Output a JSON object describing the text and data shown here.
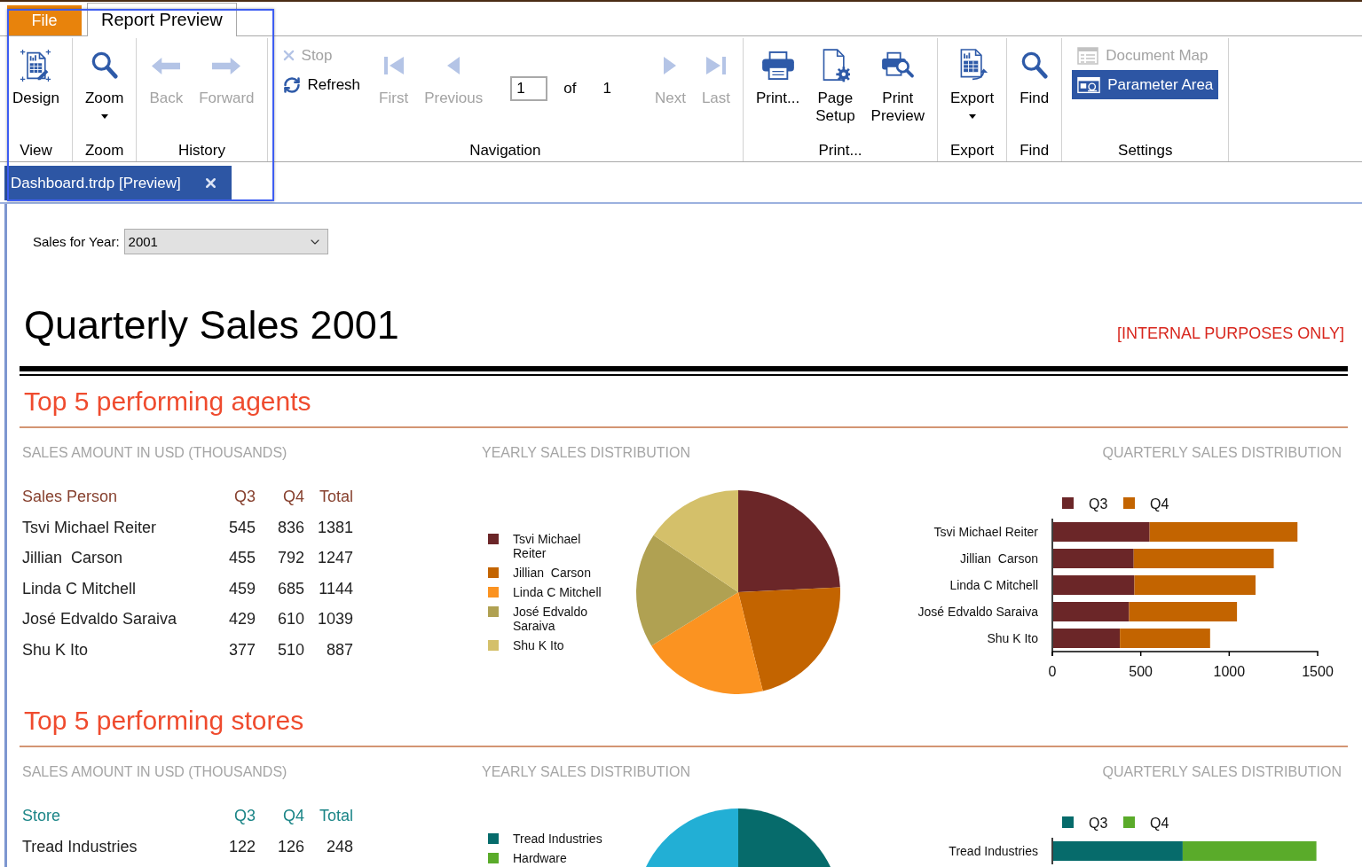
{
  "tabs": [
    {
      "label": "File",
      "kind": "menu",
      "selected": false
    },
    {
      "label": "Report Preview",
      "kind": "tab",
      "selected": true
    }
  ],
  "ribbon": {
    "groups": [
      {
        "label": "View",
        "items": [
          {
            "kind": "large",
            "label": "Design",
            "disabled": false
          }
        ]
      },
      {
        "label": "Zoom",
        "items": [
          {
            "kind": "large",
            "label": "Zoom",
            "disabled": false,
            "dropdown": true
          }
        ]
      },
      {
        "label": "History",
        "items": [
          {
            "kind": "large",
            "label": "Back",
            "disabled": true
          },
          {
            "kind": "large",
            "label": "Forward",
            "disabled": true
          }
        ]
      },
      {
        "label": "Navigation",
        "items": [
          {
            "kind": "stack",
            "buttons": [
              {
                "label": "Stop",
                "disabled": true
              },
              {
                "label": "Refresh",
                "disabled": false
              }
            ]
          },
          {
            "kind": "large",
            "label": "First",
            "disabled": true
          },
          {
            "kind": "large",
            "label": "Previous",
            "disabled": true
          },
          {
            "kind": "pager",
            "value": "1",
            "of_label": "of",
            "total": "1"
          },
          {
            "kind": "large",
            "label": "Next",
            "disabled": true
          },
          {
            "kind": "large",
            "label": "Last",
            "disabled": true
          }
        ]
      },
      {
        "label": "Print...",
        "items": [
          {
            "kind": "large",
            "label": "Print...",
            "disabled": false
          },
          {
            "kind": "large",
            "label": "Page Setup",
            "disabled": false
          },
          {
            "kind": "large",
            "label": "Print Preview",
            "disabled": false
          }
        ]
      },
      {
        "label": "Export",
        "items": [
          {
            "kind": "large",
            "label": "Export",
            "disabled": false,
            "dropdown": true
          }
        ]
      },
      {
        "label": "Find",
        "items": [
          {
            "kind": "large",
            "label": "Find",
            "disabled": false
          }
        ]
      },
      {
        "label": "Settings",
        "items": [
          {
            "kind": "stack",
            "buttons": [
              {
                "label": "Document Map",
                "disabled": true,
                "selected": false
              },
              {
                "label": "Parameter Area",
                "disabled": false,
                "selected": true
              }
            ]
          }
        ]
      }
    ]
  },
  "document_tabs": [
    {
      "label": "Dashboard.trdp [Preview]",
      "selected": true
    }
  ],
  "parameters": [
    {
      "label": "Sales for Year:",
      "value": "2001"
    }
  ],
  "report": {
    "title": "Quarterly Sales 2001",
    "notice": "[INTERNAL PURPOSES ONLY]",
    "sections": [
      {
        "title": "Top 5 performing agents",
        "color": "#87412f",
        "table": {
          "title": "SALES AMOUNT IN USD (THOUSANDS)",
          "columns": [
            "Sales Person",
            "Q3",
            "Q4",
            "Total"
          ],
          "rows": [
            [
              "Tsvi Michael Reiter",
              "545",
              "836",
              "1381"
            ],
            [
              "Jillian  Carson",
              "455",
              "792",
              "1247"
            ],
            [
              "Linda C Mitchell",
              "459",
              "685",
              "1144"
            ],
            [
              "José Edvaldo Saraiva",
              "429",
              "610",
              "1039"
            ],
            [
              "Shu K Ito",
              "377",
              "510",
              "887"
            ]
          ]
        },
        "yearly": {
          "title": "YEARLY SALES DISTRIBUTION",
          "legend": [
            {
              "label": "Tsvi Michael Reiter",
              "color": "#6b2628"
            },
            {
              "label": "Jillian  Carson",
              "color": "#c36400"
            },
            {
              "label": "Linda C Mitchell",
              "color": "#fb9321"
            },
            {
              "label": "José Edvaldo Saraiva",
              "color": "#b0a152"
            },
            {
              "label": "Shu K Ito",
              "color": "#d4c06a"
            }
          ]
        },
        "quarterly": {
          "title": "QUARTERLY SALES DISTRIBUTION",
          "chart_data": {
            "type": "bar",
            "orientation": "horizontal",
            "stacked": true,
            "legend": "top",
            "categories": [
              "Tsvi Michael Reiter",
              "Jillian  Carson",
              "Linda C Mitchell",
              "José Edvaldo Saraiva",
              "Shu K Ito"
            ],
            "series": [
              {
                "name": "Q3",
                "color": "#6b2628",
                "values": [
                  545,
                  455,
                  459,
                  429,
                  377
                ]
              },
              {
                "name": "Q4",
                "color": "#c36400",
                "values": [
                  836,
                  792,
                  685,
                  610,
                  510
                ]
              }
            ],
            "xlim": [
              0,
              1500
            ],
            "xticks": [
              0,
              500,
              1000,
              1500
            ]
          }
        }
      },
      {
        "title": "Top 5 performing stores",
        "color": "#1b8587",
        "table": {
          "title": "SALES AMOUNT IN USD (THOUSANDS)",
          "columns": [
            "Store",
            "Q3",
            "Q4",
            "Total"
          ],
          "rows": [
            [
              "Tread Industries",
              "122",
              "126",
              "248"
            ]
          ]
        },
        "yearly": {
          "title": "YEARLY SALES DISTRIBUTION",
          "legend": [
            {
              "label": "Tread Industries",
              "color": "#066b6b"
            },
            {
              "label": "Hardware",
              "color": "#5aab2a"
            }
          ]
        },
        "quarterly": {
          "title": "QUARTERLY SALES DISTRIBUTION",
          "legend": [
            {
              "label": "Q3",
              "color": "#066b6b"
            },
            {
              "label": "Q4",
              "color": "#5aab2a"
            }
          ],
          "categories": [
            "Tread Industries"
          ]
        }
      }
    ]
  }
}
